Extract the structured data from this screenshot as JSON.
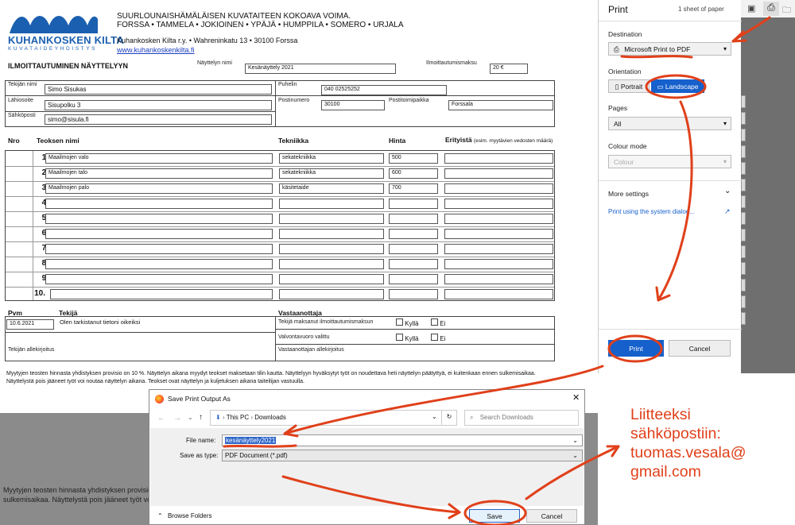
{
  "org": {
    "logo_name": "KUHANKOSKEN KILTA",
    "logo_sub": "KUVATAIDEYHDISTYS",
    "line1": "SUURLOUNAISHÄMÄLÄISEN KUVATAITEEN KOKOAVA VOIMA.",
    "line2": "FORSSA • TAMMELA • JOKIOINEN • YPÄJÄ • HUMPPILA • SOMERO • URJALA",
    "address": "Kuhankosken Kilta r.y. • Wahreninkatu 13 • 30100 Forssa",
    "url": "www.kuhankoskenkilta.fi"
  },
  "form": {
    "title": "ILMOITTAUTUMINEN NÄYTTELYYN",
    "exhibition_label": "Näyttelyn nimi",
    "exhibition_value": "Kesänäyttely 2021",
    "fee_label": "Ilmoittautumismaksu",
    "fee_value": "20 €",
    "artist_label": "Tekijän nimi",
    "artist_value": "Simo Sisukas",
    "phone_label": "Puhelin",
    "phone_value": "040 02525252",
    "address_label": "Lähiosoite",
    "address_value": "Sisupolku 3",
    "zip_label": "Postinumero",
    "zip_value": "30100",
    "city_label": "Postitoimipaikka",
    "city_value": "Forssala",
    "email_label": "Sähköposti",
    "email_value": "simo@sisula.fi",
    "col_nro": "Nro",
    "col_name": "Teoksen nimi",
    "col_tech": "Tekniikka",
    "col_price": "Hinta",
    "col_special": "Erityistä",
    "col_special_note": "(esim. myytävien vedosten määrä)",
    "rows": [
      {
        "n": "1.",
        "name": "Maailmojen valo",
        "tech": "sekatekniikka",
        "price": "500"
      },
      {
        "n": "2.",
        "name": "Maailmojen talo",
        "tech": "sekatekniikka",
        "price": "600"
      },
      {
        "n": "3.",
        "name": "Maailmojen palo",
        "tech": "käsitetaide",
        "price": "700"
      },
      {
        "n": "4.",
        "name": "",
        "tech": "",
        "price": ""
      },
      {
        "n": "5.",
        "name": "",
        "tech": "",
        "price": ""
      },
      {
        "n": "6.",
        "name": "",
        "tech": "",
        "price": ""
      },
      {
        "n": "7.",
        "name": "",
        "tech": "",
        "price": ""
      },
      {
        "n": "8.",
        "name": "",
        "tech": "",
        "price": ""
      },
      {
        "n": "9.",
        "name": "",
        "tech": "",
        "price": ""
      },
      {
        "n": "10.",
        "name": "",
        "tech": "",
        "price": ""
      }
    ],
    "date_label": "Pvm",
    "date_value": "10.6.2021",
    "maker_label": "Tekijä",
    "maker_text": "Olen tarkistanut tietoni oikeiksi",
    "receiver_label": "Vastaanottaja",
    "paid_label": "Tekijä maksanut ilmoittautumismaksun",
    "supervision_label": "Valvontavuoro valittu",
    "yes": "Kyllä",
    "no": "Ei",
    "maker_sig": "Tekijän allekirjoitus",
    "receiver_sig": "Vastaanottajan allekirjoitus",
    "footnote": "Myytyjen teosten hinnasta yhdistyksen provisio on 10 %. Näyttelyn aikana myydyt teokset maksetaan tilin kautta. Näyttelyyn hyväksytyt työt on noudettava heti näyttelyn päätyttyä, ei kuitenkaan ennen sulkemisaikaa. Näyttelystä pois jääneet työt voi noutaa näyttelyn aikana. Teokset ovat näyttelyn ja kuljetuksen aikana taiteilijan vastuulla."
  },
  "lower_text": {
    "line1": "Myytyjen teosten hinnasta yhdistyksen provisio",
    "line2": "sulkemisaikaa. Näyttelystä pois jääneet työt vo"
  },
  "print_panel": {
    "title": "Print",
    "sheets": "1 sheet of paper",
    "destination_label": "Destination",
    "destination_value": "Microsoft Print to PDF",
    "orientation_label": "Orientation",
    "portrait": "Portrait",
    "landscape": "Landscape",
    "pages_label": "Pages",
    "pages_value": "All",
    "colour_label": "Colour mode",
    "colour_value": "Colour",
    "more_settings": "More settings",
    "system_dialog": "Print using the system dialog...",
    "print_button": "Print",
    "cancel_button": "Cancel"
  },
  "dialog": {
    "title": "Save Print Output As",
    "crumb1": "This PC",
    "crumb2": "Downloads",
    "search_placeholder": "Search Downloads",
    "filename_label": "File name:",
    "filename_value": "kesänäyttely2021",
    "type_label": "Save as type:",
    "type_value": "PDF Document (*.pdf)",
    "browse": "Browse Folders",
    "save": "Save",
    "cancel": "Cancel"
  },
  "annotation": {
    "line1": "Liitteeksi",
    "line2": "sähköpostiin:",
    "line3": "tuomas.vesala@",
    "line4": "gmail.com"
  },
  "colors": {
    "accent_blue": "#1660cc",
    "annotation_red": "#e0401a",
    "logo_blue": "#1a5fb0"
  }
}
